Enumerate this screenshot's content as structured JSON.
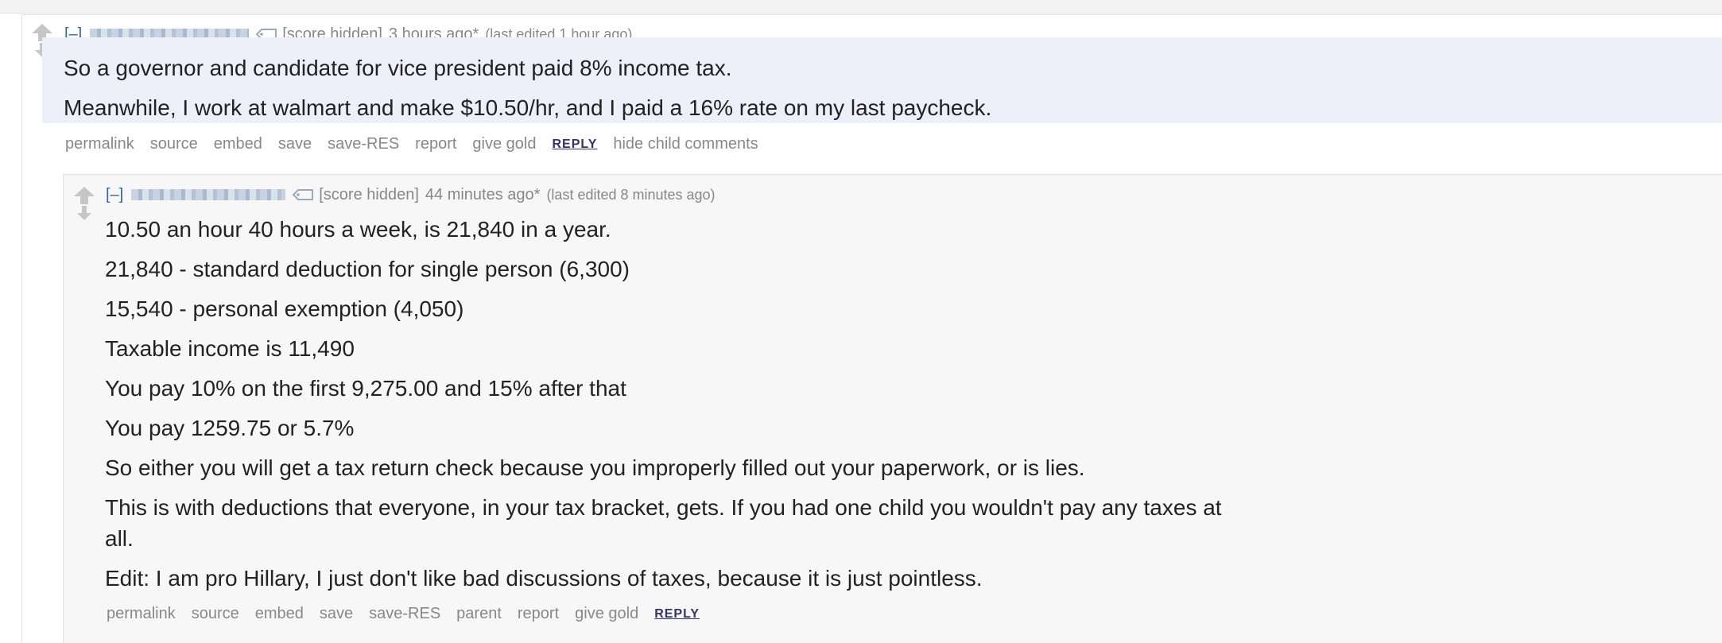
{
  "comment": {
    "expand_label": "[–]",
    "score": "[score hidden]",
    "time": "3 hours ago*",
    "edited": "(last edited 1 hour ago)",
    "paragraphs": [
      "So a governor and candidate for vice president paid 8% income tax.",
      "Meanwhile, I work at walmart and make $10.50/hr, and I paid a 16% rate on my last paycheck."
    ],
    "buttons": [
      "permalink",
      "source",
      "embed",
      "save",
      "save-RES",
      "report",
      "give gold",
      "REPLY",
      "hide child comments"
    ]
  },
  "reply": {
    "expand_label": "[–]",
    "score": "[score hidden]",
    "time": "44 minutes ago*",
    "edited": "(last edited 8 minutes ago)",
    "paragraphs": [
      "10.50 an hour 40 hours a week, is 21,840 in a year.",
      "21,840 - standard deduction for single person (6,300)",
      "15,540 - personal exemption (4,050)",
      "Taxable income is 11,490",
      "You pay 10% on the first 9,275.00 and 15% after that",
      "You pay 1259.75 or 5.7%",
      "So either you will get a tax return check because you improperly filled out your paperwork, or is lies.",
      "This is with deductions that everyone, in your tax bracket, gets. If you had one child you wouldn't pay any taxes at",
      "all.",
      "Edit: I am pro Hillary, I just don't like bad discussions of taxes, because it is just pointless."
    ],
    "buttons": [
      "permalink",
      "source",
      "embed",
      "save",
      "save-RES",
      "parent",
      "report",
      "give gold",
      "REPLY"
    ]
  },
  "icons": {
    "upvote": "upvote-arrow-icon",
    "downvote": "downvote-arrow-icon",
    "tag": "user-tag-icon"
  }
}
